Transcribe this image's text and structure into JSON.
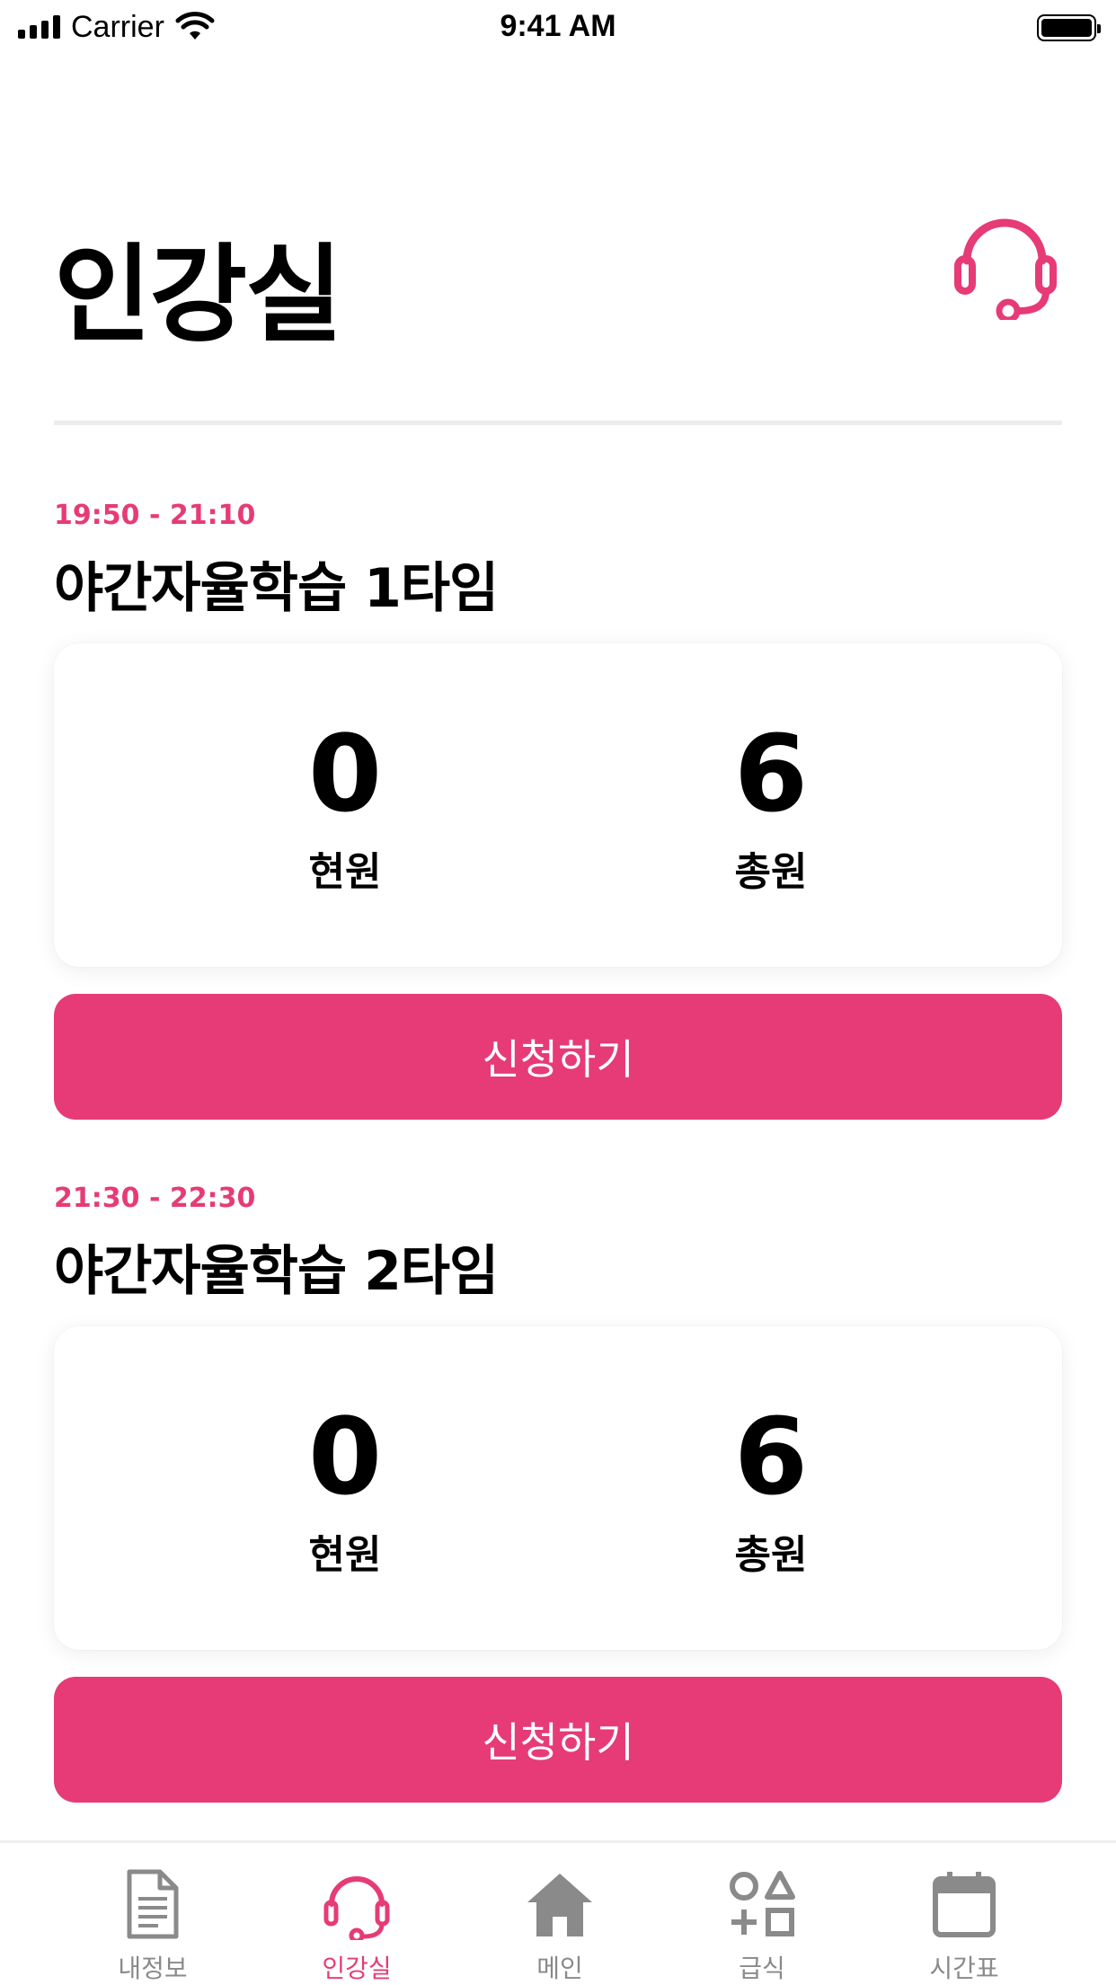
{
  "status_bar": {
    "carrier": "Carrier",
    "time": "9:41 AM"
  },
  "header": {
    "title": "인강실"
  },
  "sessions": [
    {
      "time_range": "19:50 - 21:10",
      "name": "야간자율학습 1타임",
      "current": {
        "value": "0",
        "label": "현원"
      },
      "total": {
        "value": "6",
        "label": "총원"
      },
      "button_label": "신청하기"
    },
    {
      "time_range": "21:30 - 22:30",
      "name": "야간자율학습 2타임",
      "current": {
        "value": "0",
        "label": "현원"
      },
      "total": {
        "value": "6",
        "label": "총원"
      },
      "button_label": "신청하기"
    }
  ],
  "tab_bar": {
    "items": [
      {
        "label": "내정보",
        "icon": "document-icon",
        "active": false
      },
      {
        "label": "인강실",
        "icon": "headset-icon",
        "active": true
      },
      {
        "label": "메인",
        "icon": "home-icon",
        "active": false
      },
      {
        "label": "급식",
        "icon": "shapes-icon",
        "active": false
      },
      {
        "label": "시간표",
        "icon": "calendar-icon",
        "active": false
      }
    ]
  },
  "colors": {
    "accent": "#e63b77",
    "inactive": "#8a8a8a",
    "divider": "#ececec"
  }
}
